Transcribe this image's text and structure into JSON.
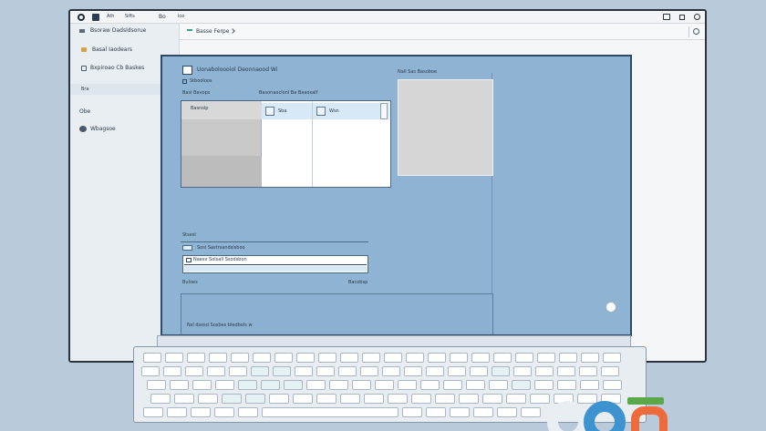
{
  "titlebar": {
    "tab1": "Ath",
    "tab2": "Sifts",
    "tab3": "Bo",
    "tab4": "ico"
  },
  "sidebar": {
    "items": [
      {
        "label": "Bsoraw Dadsldsorue"
      },
      {
        "label": "Basal Iaodears"
      },
      {
        "label": "Bxpiroao Cb Baskes"
      },
      {
        "label": "Bra"
      },
      {
        "label": "Obe"
      },
      {
        "label": "Wbagsoe"
      }
    ]
  },
  "mainbar": {
    "breadcrumb": "Basse Ferpe"
  },
  "dialog": {
    "title": "Uonaboloooiol Deonnaood Wi",
    "subtitle": "Stbooloos",
    "group_label": "Basl Bavops",
    "list_header": "Basonaoclonl Ba Baaosalf",
    "preview_label": "Nall Sas Basoboe",
    "list_row_label": "Basnslp",
    "col2_label": "Sba",
    "col3_label": "Wsn",
    "section_label": "Stsesi",
    "field1_label": "Sosi Sastrsandslsboo",
    "field2_value": "Naesv Solsall Ssodsbon",
    "hint_left": "Buloes",
    "hint_right": "Bacobsp",
    "footer_text": "Nsl dsosd Sosbes bledbols w"
  },
  "colors": {
    "dialog_bg": "#8fb3d3",
    "page_bg": "#b9cadb",
    "accent": "#2e4a66"
  }
}
